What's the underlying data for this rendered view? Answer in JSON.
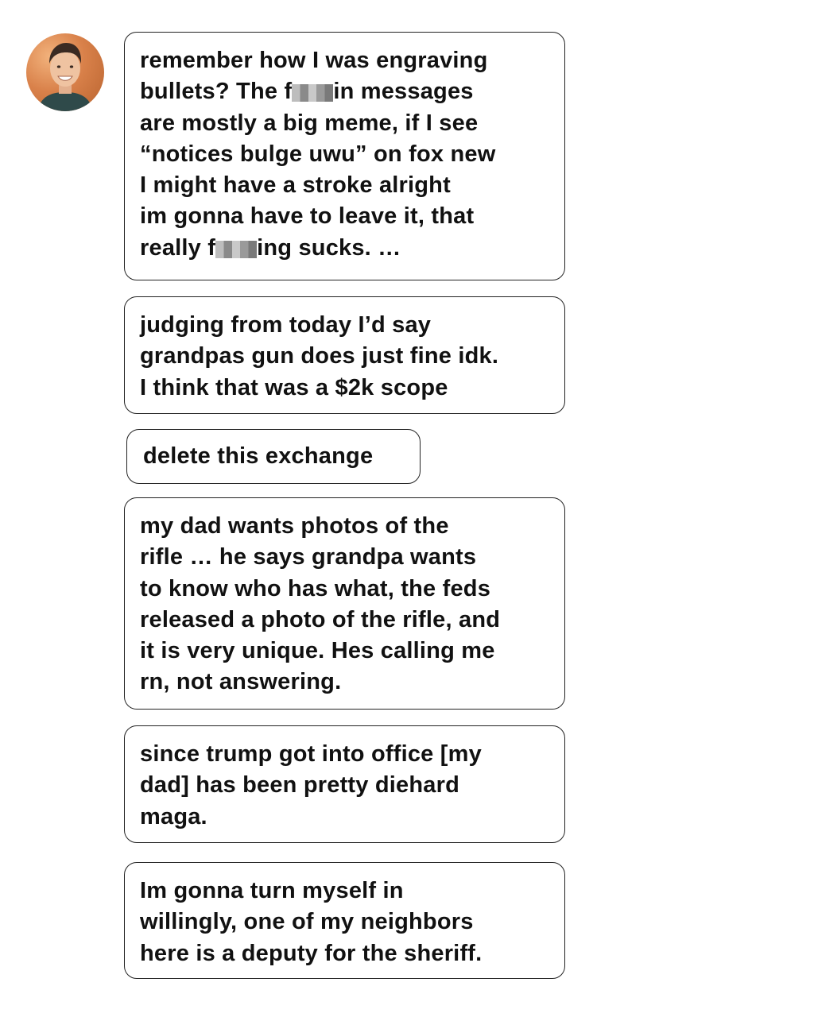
{
  "avatar": {
    "icon": "user-avatar-photo"
  },
  "messages": [
    {
      "lines": [
        {
          "text": "remember how I was engraving"
        },
        {
          "pre": "bullets? The f",
          "post": "in messages"
        },
        {
          "text": "are mostly a big meme, if I see"
        },
        {
          "text": "“notices bulge uwu” on fox new"
        },
        {
          "text": "I might have a stroke alright"
        },
        {
          "text": "im gonna have to leave it, that"
        },
        {
          "pre": "really f",
          "post": "ing sucks. …"
        }
      ]
    },
    {
      "lines": [
        {
          "text": "judging from today I’d say"
        },
        {
          "text": "grandpas gun does just fine idk."
        },
        {
          "text": "I think that was a $2k scope"
        }
      ]
    },
    {
      "lines": [
        {
          "text": "delete this exchange"
        }
      ]
    },
    {
      "lines": [
        {
          "text": "my dad wants photos of the"
        },
        {
          "text": "rifle … he says grandpa wants"
        },
        {
          "text": "to know who has what, the feds"
        },
        {
          "text": "released a photo of the rifle, and"
        },
        {
          "text": "it is very unique. Hes calling me"
        },
        {
          "text": "rn, not answering."
        }
      ]
    },
    {
      "lines": [
        {
          "text": "since trump got into office [my"
        },
        {
          "text": "dad] has been pretty diehard"
        },
        {
          "text": "maga."
        }
      ]
    },
    {
      "lines": [
        {
          "text": "Im gonna turn myself in"
        },
        {
          "text": "willingly, one of my neighbors"
        },
        {
          "text": "here is a deputy for the sheriff."
        }
      ]
    }
  ],
  "colors": {
    "bubble_border": "#222222",
    "text": "#111111",
    "background": "#ffffff"
  }
}
